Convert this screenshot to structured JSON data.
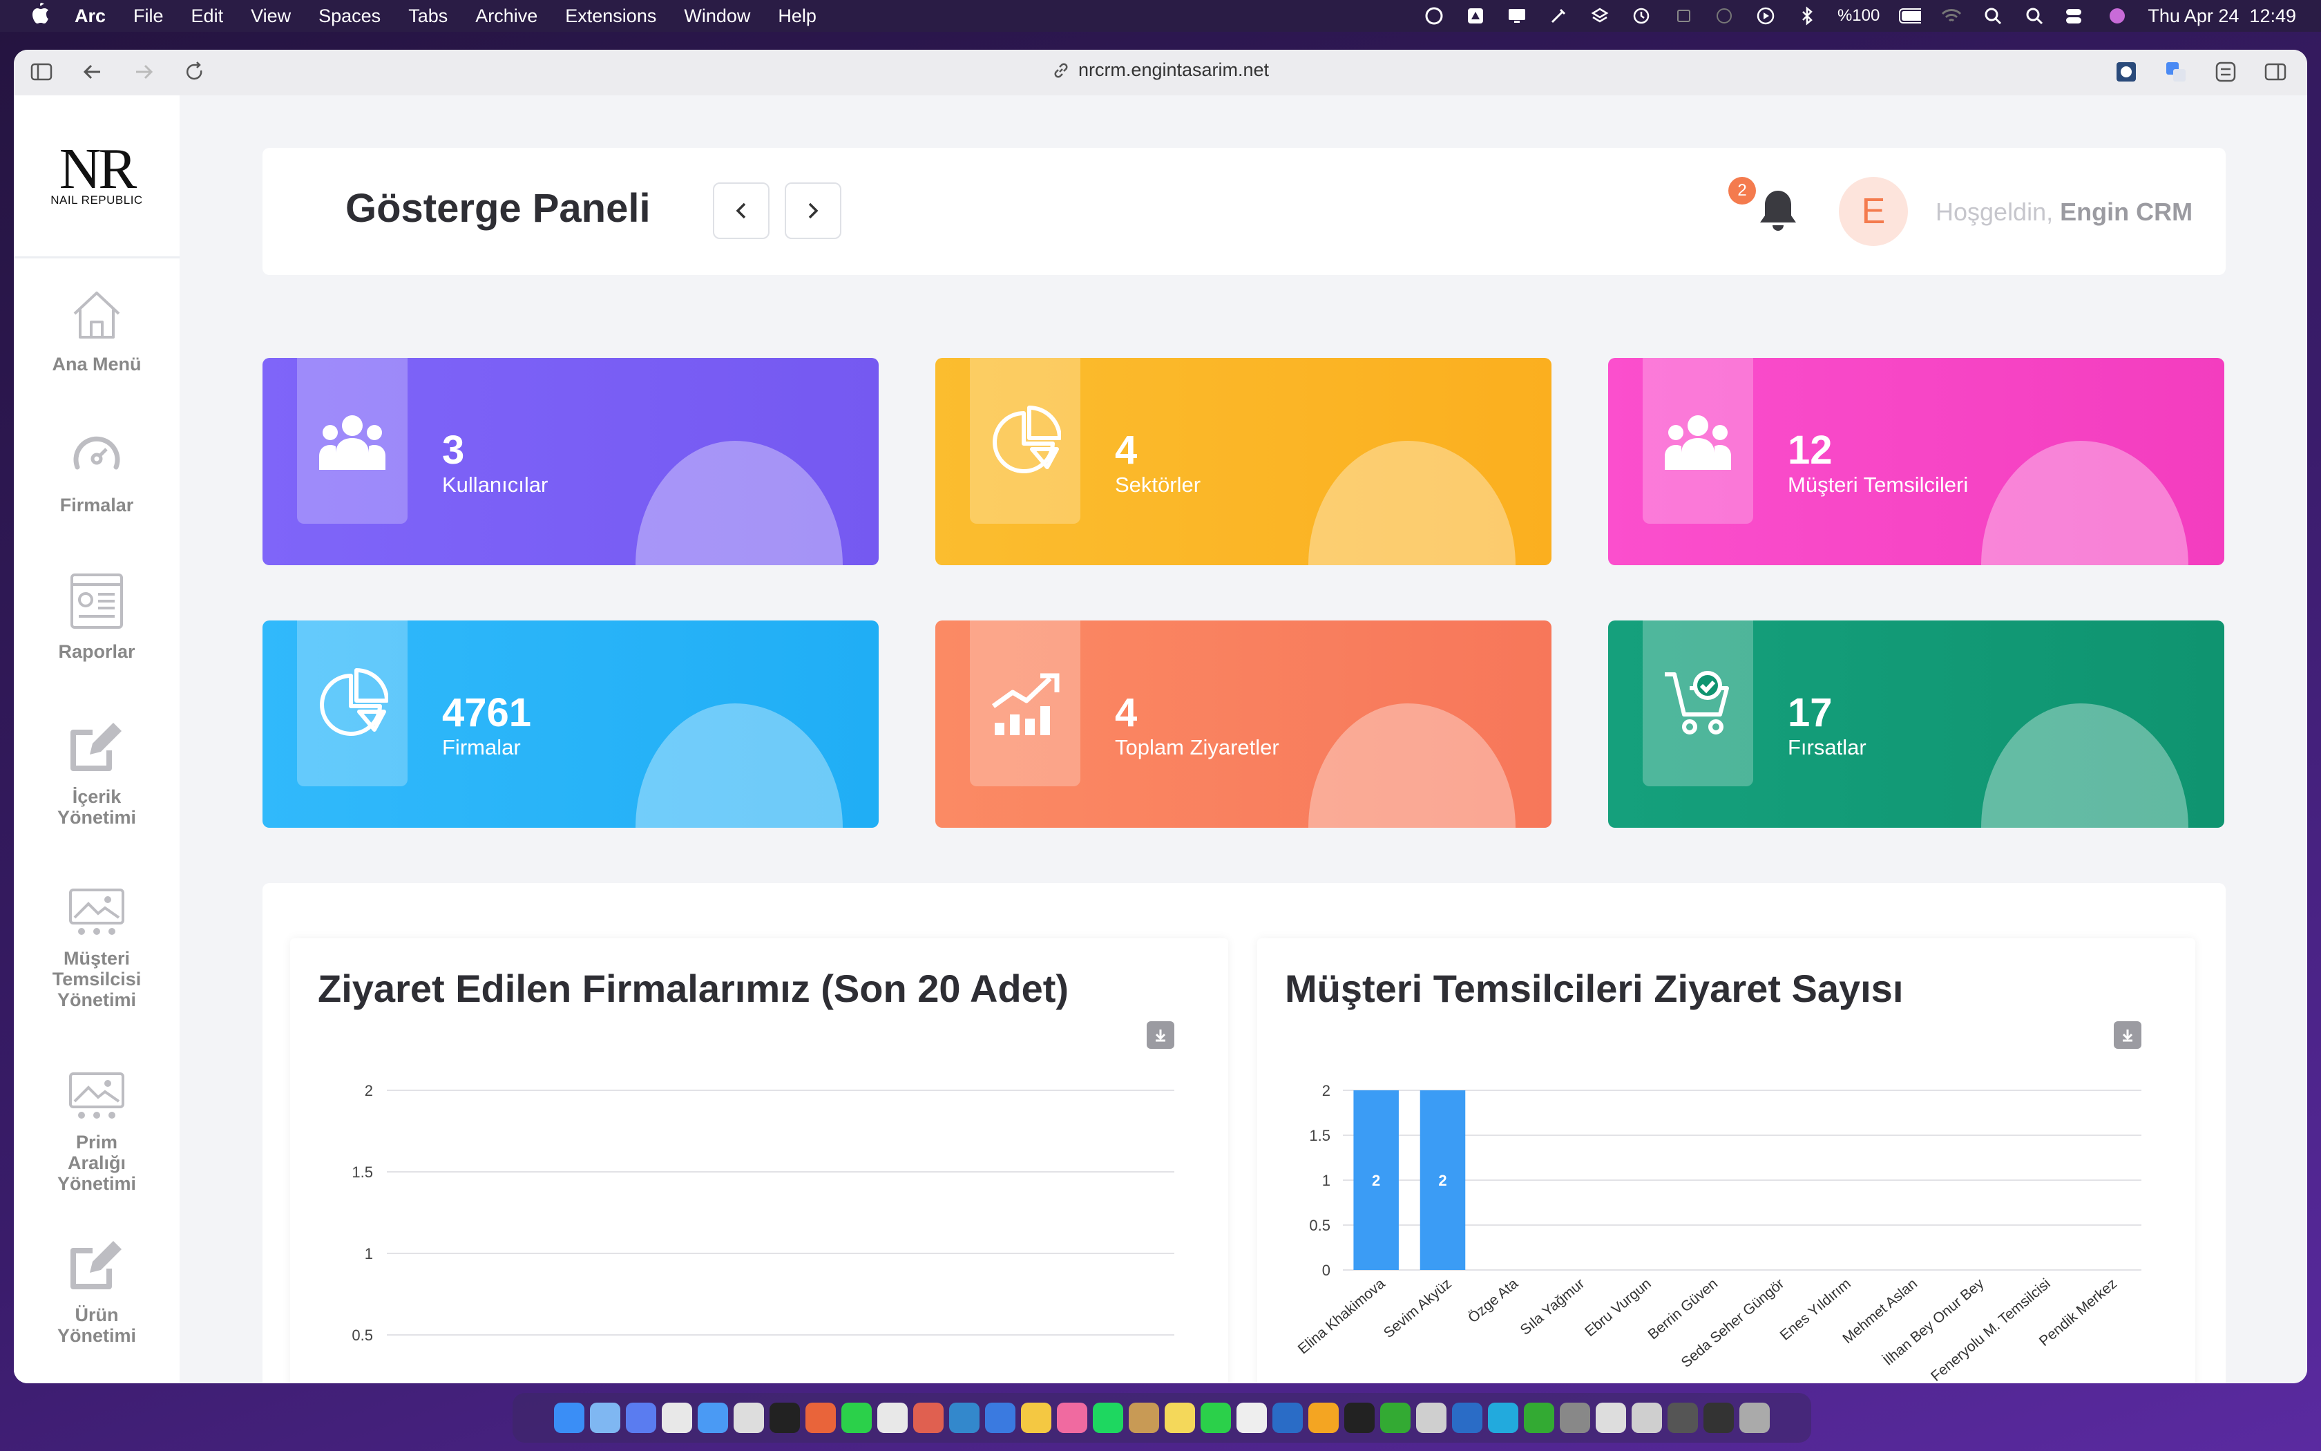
{
  "menubar": {
    "app": "Arc",
    "items": [
      "File",
      "Edit",
      "View",
      "Spaces",
      "Tabs",
      "Archive",
      "Extensions",
      "Window",
      "Help"
    ],
    "battery": "%100",
    "datetime": "Thu Apr 24  12:49"
  },
  "browser": {
    "url": "nrcrm.engintasarim.net"
  },
  "brand": {
    "logo_text": "NR",
    "logo_sub": "NAIL REPUBLIC"
  },
  "sidebar": {
    "items": [
      {
        "label": "Ana Menü",
        "icon": "home-icon"
      },
      {
        "label": "Firmalar",
        "icon": "gauge-icon"
      },
      {
        "label": "Raporlar",
        "icon": "report-icon"
      },
      {
        "label": "İçerik Yönetimi",
        "icon": "edit-icon"
      },
      {
        "label": "Müşteri Temsilcisi Yönetimi",
        "icon": "image-icon"
      },
      {
        "label": "Prim Aralığı Yönetimi",
        "icon": "image-icon"
      },
      {
        "label": "Ürün Yönetimi",
        "icon": "edit-icon"
      }
    ]
  },
  "header": {
    "title": "Gösterge Paneli",
    "notification_count": "2",
    "avatar_letter": "E",
    "greeting": "Hoşgeldin,",
    "user_name": "Engin CRM"
  },
  "stats": [
    {
      "value": "3",
      "label": "Kullanıcılar",
      "icon": "users-icon",
      "color": "#7b5ff8"
    },
    {
      "value": "4",
      "label": "Sektörler",
      "icon": "pie-chart-icon",
      "color": "#fbb52a"
    },
    {
      "value": "12",
      "label": "Müşteri Temsilcileri",
      "icon": "users-icon",
      "color": "#f646c6"
    },
    {
      "value": "4761",
      "label": "Firmalar",
      "icon": "pie-chart-icon",
      "color": "#29b4f8"
    },
    {
      "value": "4",
      "label": "Toplam Ziyaretler",
      "icon": "growth-chart-icon",
      "color": "#f98362"
    },
    {
      "value": "17",
      "label": "Fırsatlar",
      "icon": "cart-check-icon",
      "color": "#129c78"
    }
  ],
  "charts": {
    "left_title": "Ziyaret Edilen Firmalarımız (Son 20 Adet)",
    "right_title": "Müşteri Temsilcileri Ziyaret Sayısı"
  },
  "chart_data": [
    {
      "type": "bar",
      "title": "Ziyaret Edilen Firmalarımız (Son 20 Adet)",
      "yticks": [
        "2",
        "1.5",
        "1",
        "0.5"
      ],
      "ylim": [
        0,
        2
      ],
      "categories": [],
      "values": [],
      "grid": true
    },
    {
      "type": "bar",
      "title": "Müşteri Temsilcileri Ziyaret Sayısı",
      "ylim": [
        0,
        2
      ],
      "yticks": [
        "2",
        "1.5",
        "1",
        "0.5",
        "0"
      ],
      "categories": [
        "Elina Khakimova",
        "Sevim Akyüz",
        "Özge Ata",
        "Sıla Yağmur",
        "Ebru Vurgun",
        "Berrin Güven",
        "Seda Seher Güngör",
        "Enes Yıldırım",
        "Mehmet Aslan",
        "İlhan Bey Onur Bey",
        "Feneryolu M. Temsilcisi",
        "Pendik Merkez"
      ],
      "values": [
        2,
        2,
        0,
        0,
        0,
        0,
        0,
        0,
        0,
        0,
        0,
        0
      ],
      "color": "#3b9cf5",
      "grid": true
    }
  ]
}
